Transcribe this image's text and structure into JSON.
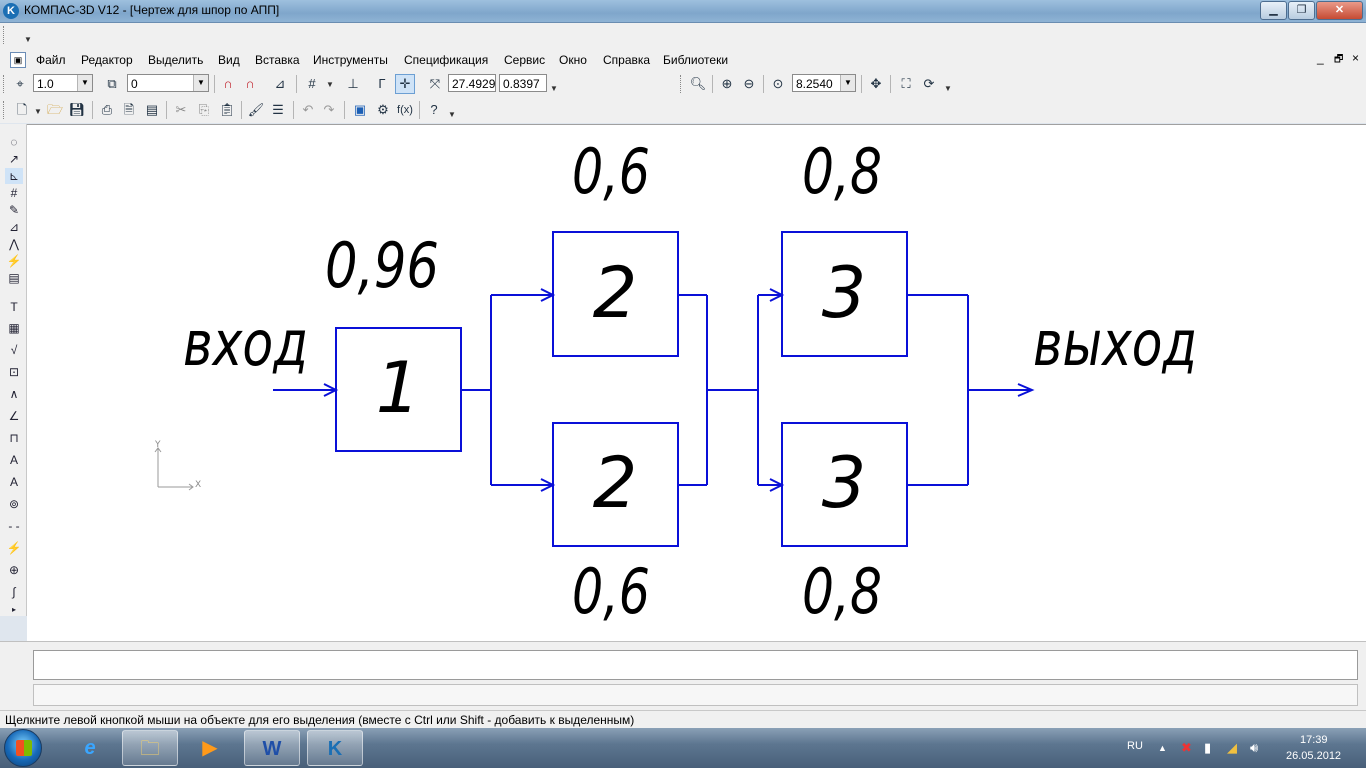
{
  "window": {
    "title": "КОМПАС-3D V12 - [Чертеж для шпор по АПП]",
    "app_icon": "kompas-logo-icon",
    "minimize": "▁",
    "maximize": "❐",
    "close": "✕"
  },
  "menu": {
    "items": [
      {
        "label": "Файл"
      },
      {
        "label": "Редактор"
      },
      {
        "label": "Выделить"
      },
      {
        "label": "Вид"
      },
      {
        "label": "Вставка"
      },
      {
        "label": "Инструменты"
      },
      {
        "label": "Спецификация"
      },
      {
        "label": "Сервис"
      },
      {
        "label": "Окно"
      },
      {
        "label": "Справка"
      },
      {
        "label": "Библиотеки"
      }
    ],
    "doc_controls": {
      "min": "_",
      "restore": "🗗",
      "close": "×"
    }
  },
  "toolbar": {
    "line_scale": "1.0",
    "layer": "0",
    "coord_x": "27.4929",
    "coord_y": "0.8397",
    "zoom": "8.2540"
  },
  "diagram": {
    "input_label": "вход",
    "output_label": "выход",
    "blocks": [
      {
        "id": "1",
        "label": "1",
        "reliability": "0,96"
      },
      {
        "id": "2a",
        "label": "2",
        "reliability": "0,6"
      },
      {
        "id": "2b",
        "label": "2",
        "reliability": "0,6"
      },
      {
        "id": "3a",
        "label": "3",
        "reliability": "0,8"
      },
      {
        "id": "3b",
        "label": "3",
        "reliability": "0,8"
      }
    ],
    "axis": {
      "x": "X",
      "y": "Y"
    },
    "line_color": "#0a10d8"
  },
  "status": {
    "hint": "Щелкните левой кнопкой мыши на объекте для его выделения (вместе с Ctrl или Shift - добавить к выделенным)"
  },
  "taskbar": {
    "apps": [
      {
        "name": "internet-explorer-icon",
        "glyph": "e"
      },
      {
        "name": "explorer-folder-icon",
        "glyph": "🗀"
      },
      {
        "name": "media-player-icon",
        "glyph": "▶"
      },
      {
        "name": "word-icon",
        "glyph": "W"
      },
      {
        "name": "kompas-icon",
        "glyph": "K"
      }
    ],
    "language": "RU",
    "time": "17:39",
    "date": "26.05.2012"
  }
}
